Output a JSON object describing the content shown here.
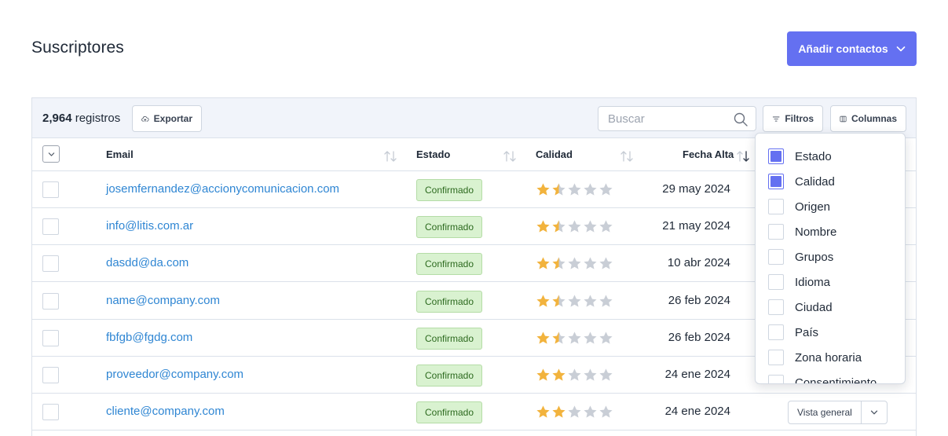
{
  "page": {
    "title": "Suscriptores"
  },
  "colors": {
    "accent": "#6470f1",
    "link": "#2f86d3",
    "badge_bg": "#d9f2d0",
    "star_on": "#f2b33d",
    "star_off": "#c9ced6"
  },
  "header": {
    "add_button_label": "Añadir contactos"
  },
  "toolbar": {
    "count_value": "2,964",
    "count_suffix": " registros",
    "export_label": "Exportar",
    "search_placeholder": "Buscar",
    "search_value": "",
    "filters_label": "Filtros",
    "columns_label": "Columnas"
  },
  "table": {
    "columns": {
      "email": "Email",
      "estado": "Estado",
      "calidad": "Calidad",
      "fecha": "Fecha Alta"
    },
    "rows": [
      {
        "email": "josemfernandez@accionycomunicacion.com",
        "estado": "Confirmado",
        "quality": 1.5,
        "date": "29 may 2024"
      },
      {
        "email": "info@litis.com.ar",
        "estado": "Confirmado",
        "quality": 1.5,
        "date": "21 may 2024"
      },
      {
        "email": "dasdd@da.com",
        "estado": "Confirmado",
        "quality": 1.5,
        "date": "10 abr 2024"
      },
      {
        "email": "name@company.com",
        "estado": "Confirmado",
        "quality": 1.5,
        "date": "26 feb 2024"
      },
      {
        "email": "fbfgb@fgdg.com",
        "estado": "Confirmado",
        "quality": 1.5,
        "date": "26 feb 2024"
      },
      {
        "email": "proveedor@company.com",
        "estado": "Confirmado",
        "quality": 2,
        "date": "24 ene 2024"
      },
      {
        "email": "cliente@company.com",
        "estado": "Confirmado",
        "quality": 2,
        "date": "24 ene 2024"
      }
    ],
    "row_action_label": "Vista general"
  },
  "columns_menu": {
    "items": [
      {
        "label": "Estado",
        "checked": true
      },
      {
        "label": "Calidad",
        "checked": true
      },
      {
        "label": "Origen",
        "checked": false
      },
      {
        "label": "Nombre",
        "checked": false
      },
      {
        "label": "Grupos",
        "checked": false
      },
      {
        "label": "Idioma",
        "checked": false
      },
      {
        "label": "Ciudad",
        "checked": false
      },
      {
        "label": "País",
        "checked": false
      },
      {
        "label": "Zona horaria",
        "checked": false
      },
      {
        "label": "Consentimiento",
        "checked": false
      }
    ]
  },
  "icons": {
    "add": "chevron-down-icon",
    "export": "cloud-upload-icon",
    "search": "search-icon",
    "filters": "filter-icon",
    "columns": "columns-icon",
    "sort": "sort-icon"
  }
}
